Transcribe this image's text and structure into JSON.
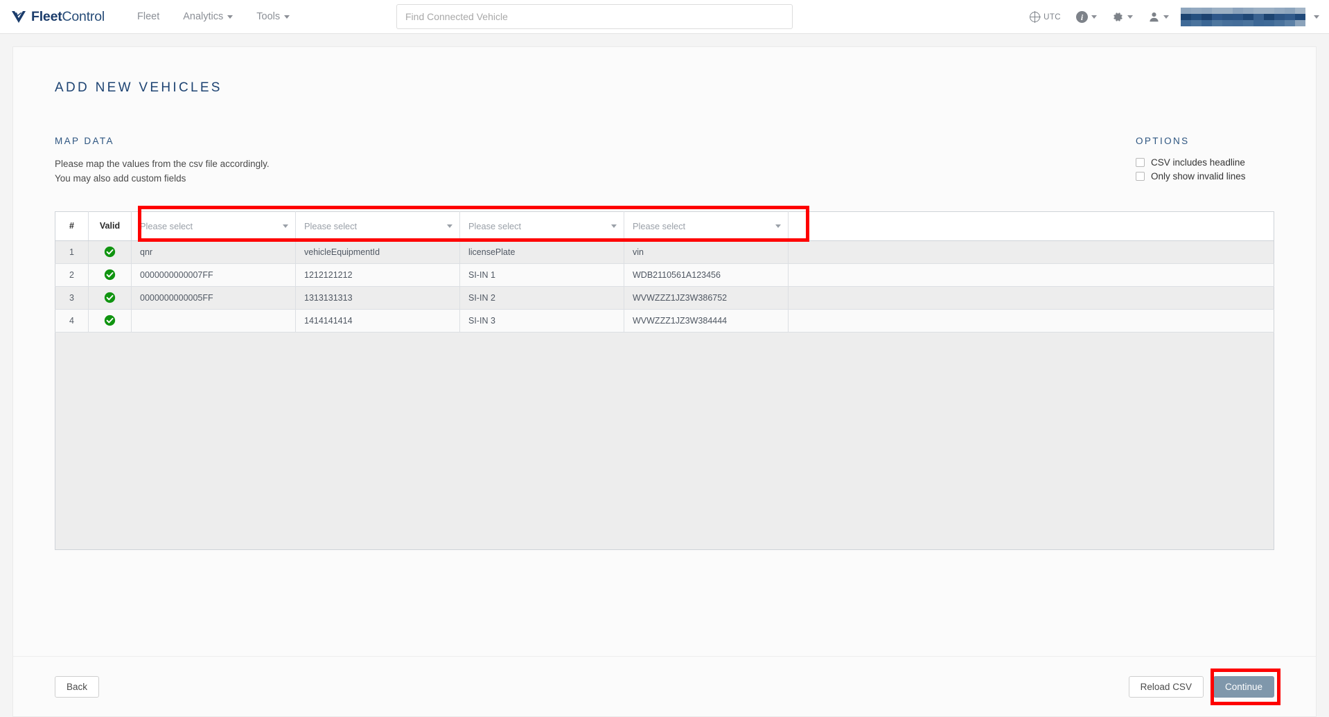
{
  "header": {
    "brand": {
      "bold": "Fleet",
      "light": "Control",
      "logo_icon": "fleet-chevron-logo"
    },
    "nav": [
      {
        "label": "Fleet",
        "has_caret": false
      },
      {
        "label": "Analytics",
        "has_caret": true
      },
      {
        "label": "Tools",
        "has_caret": true
      }
    ],
    "search": {
      "placeholder": "Find Connected Vehicle",
      "value": ""
    },
    "timezone": "UTC",
    "icons": {
      "globe": "globe-icon",
      "info": "i",
      "gear": "gear-icon",
      "user": "user-icon"
    },
    "account_redacted": true
  },
  "page": {
    "title": "ADD NEW VEHICLES"
  },
  "map_data": {
    "heading": "MAP DATA",
    "description_line1": "Please map the values from the csv file accordingly.",
    "description_line2": "You may also add custom fields"
  },
  "options": {
    "heading": "OPTIONS",
    "items": [
      {
        "label": "CSV includes headline",
        "checked": false
      },
      {
        "label": "Only show invalid lines",
        "checked": false
      }
    ]
  },
  "table": {
    "static_headers": [
      "#",
      "Valid"
    ],
    "mapping_placeholder": "Please select",
    "mapping_columns": 4,
    "rows": [
      {
        "num": "1",
        "valid": true,
        "cells": [
          "qnr",
          "vehicleEquipmentId",
          "licensePlate",
          "vin"
        ]
      },
      {
        "num": "2",
        "valid": true,
        "cells": [
          "0000000000007FF",
          "1212121212",
          "SI-IN 1",
          "WDB2110561A123456"
        ]
      },
      {
        "num": "3",
        "valid": true,
        "cells": [
          "0000000000005FF",
          "1313131313",
          "SI-IN 2",
          "WVWZZZ1JZ3W386752"
        ]
      },
      {
        "num": "4",
        "valid": true,
        "cells": [
          "",
          "1414141414",
          "SI-IN 3",
          "WVWZZZ1JZ3W384444"
        ]
      }
    ],
    "valid_icon": "green-check-icon"
  },
  "footer": {
    "back_label": "Back",
    "reload_label": "Reload CSV",
    "continue_label": "Continue"
  },
  "annotations": {
    "highlight_color": "#fe0000",
    "boxes": [
      "mapping-dropdowns-row",
      "continue-button"
    ]
  },
  "colors": {
    "brand_blue": "#1b3c6b",
    "title_blue": "#1d4372",
    "primary_button": "#7f97ab",
    "valid_green": "#118811",
    "annotation_red": "#fe0000"
  }
}
